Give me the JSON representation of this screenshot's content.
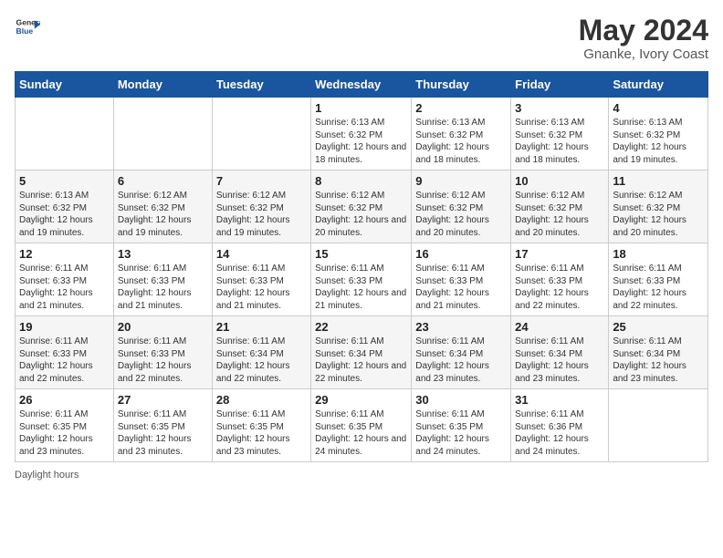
{
  "header": {
    "logo_line1": "General",
    "logo_line2": "Blue",
    "month_year": "May 2024",
    "location": "Gnanke, Ivory Coast"
  },
  "weekdays": [
    "Sunday",
    "Monday",
    "Tuesday",
    "Wednesday",
    "Thursday",
    "Friday",
    "Saturday"
  ],
  "weeks": [
    [
      {
        "day": "",
        "info": ""
      },
      {
        "day": "",
        "info": ""
      },
      {
        "day": "",
        "info": ""
      },
      {
        "day": "1",
        "info": "Sunrise: 6:13 AM\nSunset: 6:32 PM\nDaylight: 12 hours and 18 minutes."
      },
      {
        "day": "2",
        "info": "Sunrise: 6:13 AM\nSunset: 6:32 PM\nDaylight: 12 hours and 18 minutes."
      },
      {
        "day": "3",
        "info": "Sunrise: 6:13 AM\nSunset: 6:32 PM\nDaylight: 12 hours and 18 minutes."
      },
      {
        "day": "4",
        "info": "Sunrise: 6:13 AM\nSunset: 6:32 PM\nDaylight: 12 hours and 19 minutes."
      }
    ],
    [
      {
        "day": "5",
        "info": "Sunrise: 6:13 AM\nSunset: 6:32 PM\nDaylight: 12 hours and 19 minutes."
      },
      {
        "day": "6",
        "info": "Sunrise: 6:12 AM\nSunset: 6:32 PM\nDaylight: 12 hours and 19 minutes."
      },
      {
        "day": "7",
        "info": "Sunrise: 6:12 AM\nSunset: 6:32 PM\nDaylight: 12 hours and 19 minutes."
      },
      {
        "day": "8",
        "info": "Sunrise: 6:12 AM\nSunset: 6:32 PM\nDaylight: 12 hours and 20 minutes."
      },
      {
        "day": "9",
        "info": "Sunrise: 6:12 AM\nSunset: 6:32 PM\nDaylight: 12 hours and 20 minutes."
      },
      {
        "day": "10",
        "info": "Sunrise: 6:12 AM\nSunset: 6:32 PM\nDaylight: 12 hours and 20 minutes."
      },
      {
        "day": "11",
        "info": "Sunrise: 6:12 AM\nSunset: 6:32 PM\nDaylight: 12 hours and 20 minutes."
      }
    ],
    [
      {
        "day": "12",
        "info": "Sunrise: 6:11 AM\nSunset: 6:33 PM\nDaylight: 12 hours and 21 minutes."
      },
      {
        "day": "13",
        "info": "Sunrise: 6:11 AM\nSunset: 6:33 PM\nDaylight: 12 hours and 21 minutes."
      },
      {
        "day": "14",
        "info": "Sunrise: 6:11 AM\nSunset: 6:33 PM\nDaylight: 12 hours and 21 minutes."
      },
      {
        "day": "15",
        "info": "Sunrise: 6:11 AM\nSunset: 6:33 PM\nDaylight: 12 hours and 21 minutes."
      },
      {
        "day": "16",
        "info": "Sunrise: 6:11 AM\nSunset: 6:33 PM\nDaylight: 12 hours and 21 minutes."
      },
      {
        "day": "17",
        "info": "Sunrise: 6:11 AM\nSunset: 6:33 PM\nDaylight: 12 hours and 22 minutes."
      },
      {
        "day": "18",
        "info": "Sunrise: 6:11 AM\nSunset: 6:33 PM\nDaylight: 12 hours and 22 minutes."
      }
    ],
    [
      {
        "day": "19",
        "info": "Sunrise: 6:11 AM\nSunset: 6:33 PM\nDaylight: 12 hours and 22 minutes."
      },
      {
        "day": "20",
        "info": "Sunrise: 6:11 AM\nSunset: 6:33 PM\nDaylight: 12 hours and 22 minutes."
      },
      {
        "day": "21",
        "info": "Sunrise: 6:11 AM\nSunset: 6:34 PM\nDaylight: 12 hours and 22 minutes."
      },
      {
        "day": "22",
        "info": "Sunrise: 6:11 AM\nSunset: 6:34 PM\nDaylight: 12 hours and 22 minutes."
      },
      {
        "day": "23",
        "info": "Sunrise: 6:11 AM\nSunset: 6:34 PM\nDaylight: 12 hours and 23 minutes."
      },
      {
        "day": "24",
        "info": "Sunrise: 6:11 AM\nSunset: 6:34 PM\nDaylight: 12 hours and 23 minutes."
      },
      {
        "day": "25",
        "info": "Sunrise: 6:11 AM\nSunset: 6:34 PM\nDaylight: 12 hours and 23 minutes."
      }
    ],
    [
      {
        "day": "26",
        "info": "Sunrise: 6:11 AM\nSunset: 6:35 PM\nDaylight: 12 hours and 23 minutes."
      },
      {
        "day": "27",
        "info": "Sunrise: 6:11 AM\nSunset: 6:35 PM\nDaylight: 12 hours and 23 minutes."
      },
      {
        "day": "28",
        "info": "Sunrise: 6:11 AM\nSunset: 6:35 PM\nDaylight: 12 hours and 23 minutes."
      },
      {
        "day": "29",
        "info": "Sunrise: 6:11 AM\nSunset: 6:35 PM\nDaylight: 12 hours and 24 minutes."
      },
      {
        "day": "30",
        "info": "Sunrise: 6:11 AM\nSunset: 6:35 PM\nDaylight: 12 hours and 24 minutes."
      },
      {
        "day": "31",
        "info": "Sunrise: 6:11 AM\nSunset: 6:36 PM\nDaylight: 12 hours and 24 minutes."
      },
      {
        "day": "",
        "info": ""
      }
    ]
  ],
  "footer": {
    "daylight_label": "Daylight hours"
  }
}
